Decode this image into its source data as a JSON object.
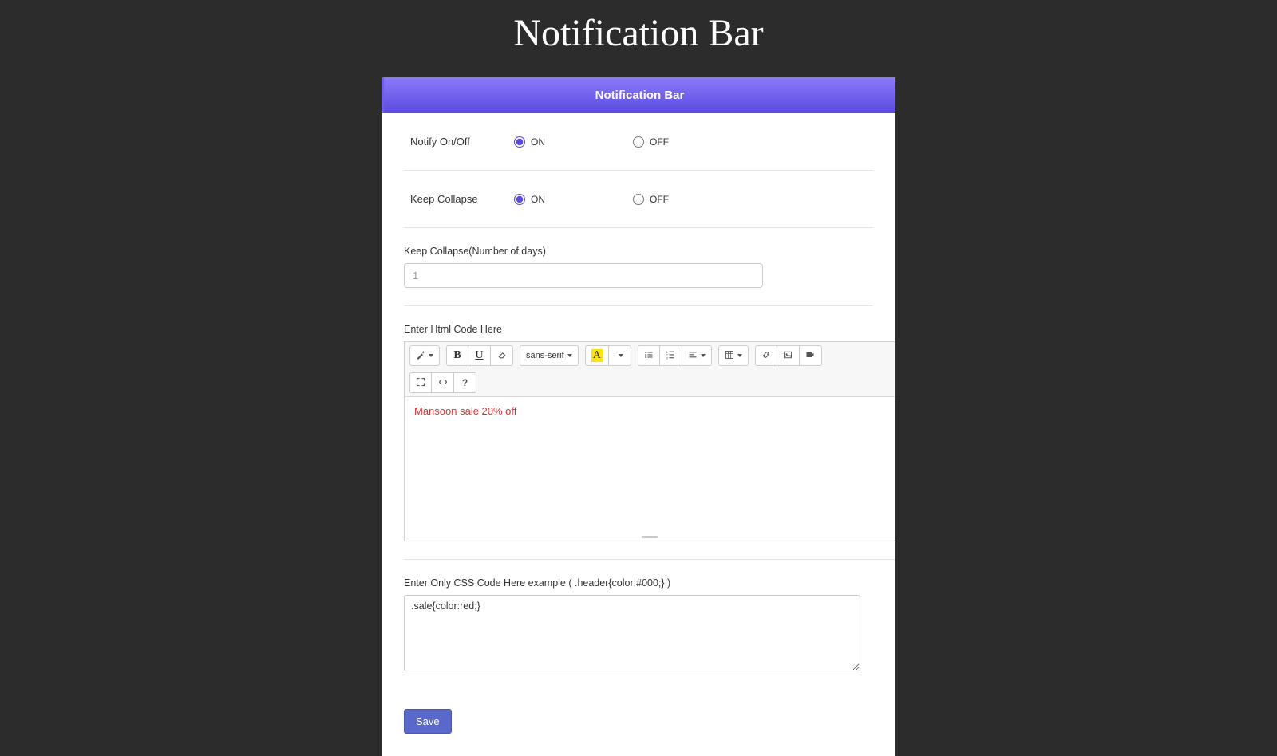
{
  "page": {
    "title": "Notification Bar"
  },
  "panel": {
    "header": "Notification Bar"
  },
  "fields": {
    "notify": {
      "label": "Notify On/Off",
      "on_label": "ON",
      "off_label": "OFF",
      "value": "ON"
    },
    "collapse": {
      "label": "Keep Collapse",
      "on_label": "ON",
      "off_label": "OFF",
      "value": "ON"
    },
    "collapse_days": {
      "label": "Keep Collapse(Number of days)",
      "placeholder": "1",
      "value": ""
    },
    "html_code": {
      "label": "Enter Html Code Here",
      "content": "Mansoon sale 20% off"
    },
    "css_code": {
      "label": "Enter Only CSS Code Here example ( .header{color:#000;} )",
      "value": ".sale{color:red;}"
    }
  },
  "editor_toolbar": {
    "font_family": "sans-serif"
  },
  "actions": {
    "save": "Save"
  }
}
